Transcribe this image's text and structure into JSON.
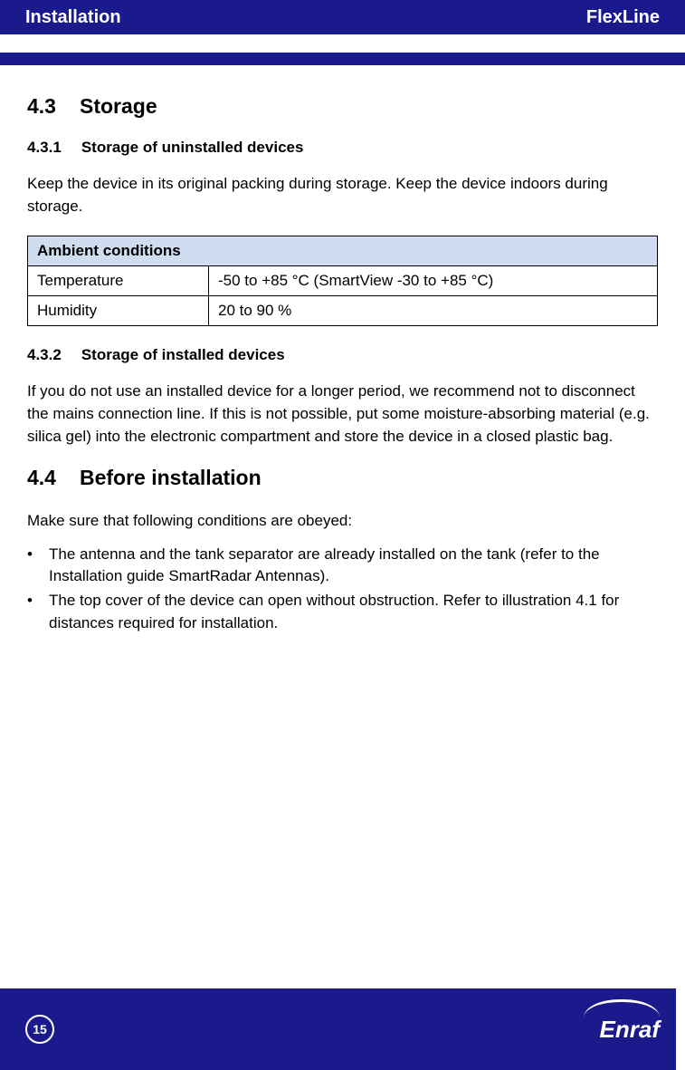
{
  "header": {
    "left": "Installation",
    "right": "FlexLine"
  },
  "sections": {
    "storage": {
      "num": "4.3",
      "title": "Storage",
      "s1": {
        "num": "4.3.1",
        "title": "Storage of uninstalled devices",
        "body": "Keep the device in its original packing during storage. Keep the device indoors during storage."
      },
      "table": {
        "header": "Ambient conditions",
        "rows": [
          {
            "label": "Temperature",
            "value": "-50 to +85 °C (SmartView -30 to +85 °C)"
          },
          {
            "label": "Humidity",
            "value": " 20 to 90 %"
          }
        ]
      },
      "s2": {
        "num": "4.3.2",
        "title": "Storage of installed devices",
        "body": "If you do not use an installed device for a longer period, we recommend not to disconnect the mains connection line. If this is not possible, put some moisture-absorbing material (e.g. silica gel) into the electronic compartment and store the device in a closed plastic bag."
      }
    },
    "before": {
      "num": "4.4",
      "title": "Before installation",
      "intro": "Make sure that following conditions are obeyed:",
      "bullets": [
        "The antenna and the tank separator are already installed on the tank (refer to the Installation guide SmartRadar Antennas).",
        "The top cover of the device can open without obstruction. Refer to illustration 4.1 for distances required for installation."
      ]
    }
  },
  "footer": {
    "page": "15",
    "brand": "Enraf"
  }
}
